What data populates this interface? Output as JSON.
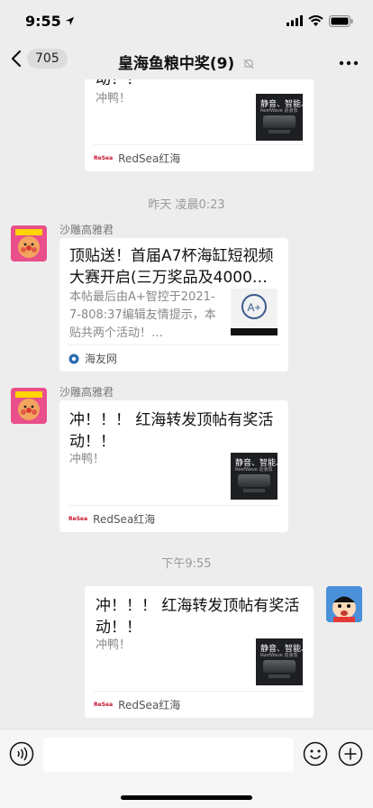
{
  "status": {
    "time": "9:55"
  },
  "nav": {
    "back_count": "705",
    "title": "皇海鱼粮中奖(9)"
  },
  "messages": {
    "m1": {
      "title": "动！！",
      "desc": "冲鸭！",
      "source": "RedSea红海",
      "thumb_line1": "静音、智能、强劲",
      "thumb_line2": "ReefWave 造浪泵"
    },
    "sep1": "昨天 凌晨0:23",
    "m2": {
      "sender": "沙雕高雅君",
      "title": "顶贴送！首届A7杯海缸短视频大赛开启(三万奖品及4000…",
      "desc": "本帖最后由A+智控于2021-7-808:37编辑友情提示，本贴共两个活动！…",
      "source": "海友网",
      "thumb_text": "A+"
    },
    "m3": {
      "sender": "沙雕高雅君",
      "title": "冲！！！ 红海转发顶帖有奖活动！！",
      "desc": "冲鸭！",
      "source": "RedSea红海",
      "thumb_line1": "静音、智能、强劲",
      "thumb_line2": "ReefWave 造浪泵"
    },
    "sep2": "下午9:55",
    "m4": {
      "title": "冲！！！ 红海转发顶帖有奖活动！！",
      "desc": "冲鸭！",
      "source": "RedSea红海",
      "thumb_line1": "静音、智能、强劲",
      "thumb_line2": "ReefWave 造浪泵"
    }
  },
  "colors": {
    "background": "#ededed",
    "card": "#ffffff",
    "meta_text": "#9a9a9a"
  }
}
